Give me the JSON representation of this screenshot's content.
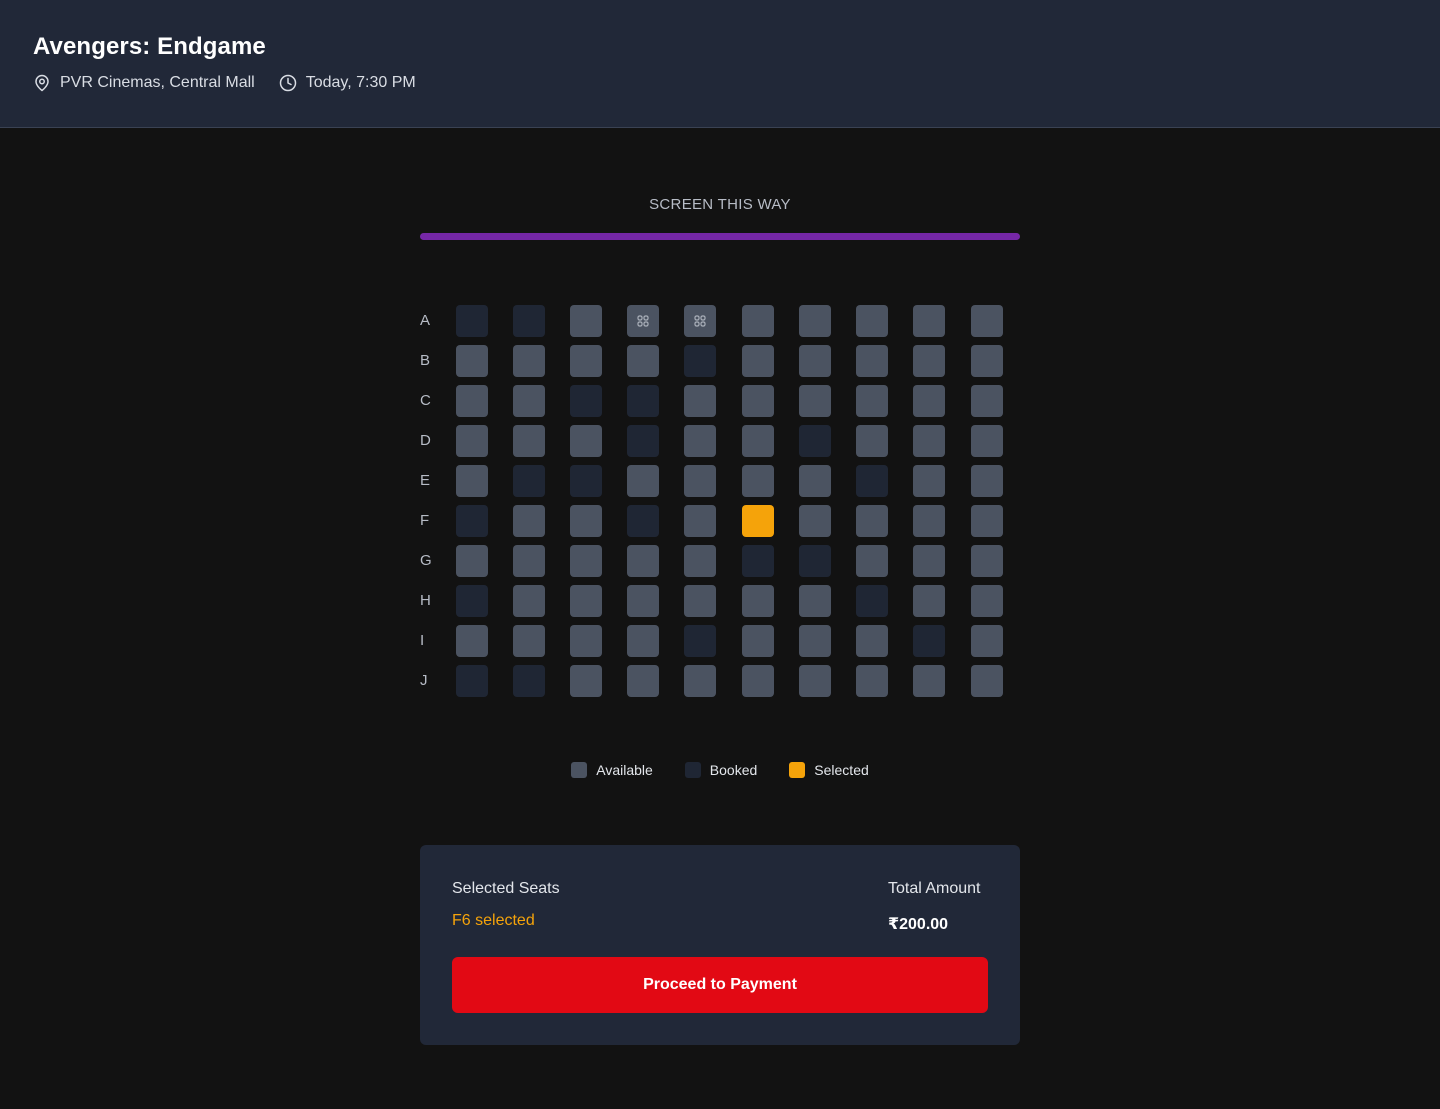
{
  "header": {
    "title": "Avengers: Endgame",
    "venue": "PVR Cinemas, Central Mall",
    "showtime": "Today, 7:30 PM",
    "venue_icon": "map-pin-icon",
    "time_icon": "clock-icon"
  },
  "screen": {
    "label": "SCREEN THIS WAY",
    "bar_color": "#7527a6"
  },
  "seat_map": {
    "rows": [
      "A",
      "B",
      "C",
      "D",
      "E",
      "F",
      "G",
      "H",
      "I",
      "J"
    ],
    "seats_per_row": 10,
    "statuses": [
      [
        "booked",
        "booked",
        "available",
        "special",
        "special",
        "available",
        "available",
        "available",
        "available",
        "available"
      ],
      [
        "available",
        "available",
        "available",
        "available",
        "booked",
        "available",
        "available",
        "available",
        "available",
        "available"
      ],
      [
        "available",
        "available",
        "booked",
        "booked",
        "available",
        "available",
        "available",
        "available",
        "available",
        "available"
      ],
      [
        "available",
        "available",
        "available",
        "booked",
        "available",
        "available",
        "booked",
        "available",
        "available",
        "available"
      ],
      [
        "available",
        "booked",
        "booked",
        "available",
        "available",
        "available",
        "available",
        "booked",
        "available",
        "available"
      ],
      [
        "booked",
        "available",
        "available",
        "booked",
        "available",
        "selected",
        "available",
        "available",
        "available",
        "available"
      ],
      [
        "available",
        "available",
        "available",
        "available",
        "available",
        "booked",
        "booked",
        "available",
        "available",
        "available"
      ],
      [
        "booked",
        "available",
        "available",
        "available",
        "available",
        "available",
        "available",
        "booked",
        "available",
        "available"
      ],
      [
        "available",
        "available",
        "available",
        "available",
        "booked",
        "available",
        "available",
        "available",
        "booked",
        "available"
      ],
      [
        "booked",
        "booked",
        "available",
        "available",
        "available",
        "available",
        "available",
        "available",
        "available",
        "available"
      ]
    ],
    "colors": {
      "available": "#4b5361",
      "booked": "#1f2634",
      "selected": "#f5a30a",
      "special": "#4b5361"
    },
    "special_icon": "seat-grid-icon"
  },
  "legend": {
    "available": "Available",
    "booked": "Booked",
    "selected": "Selected"
  },
  "summary": {
    "seats_label": "Selected Seats",
    "seats_value": "F6 selected",
    "total_label": "Total Amount",
    "total_value": "₹200.00",
    "button_label": "Proceed to Payment",
    "button_color": "#e20914"
  }
}
